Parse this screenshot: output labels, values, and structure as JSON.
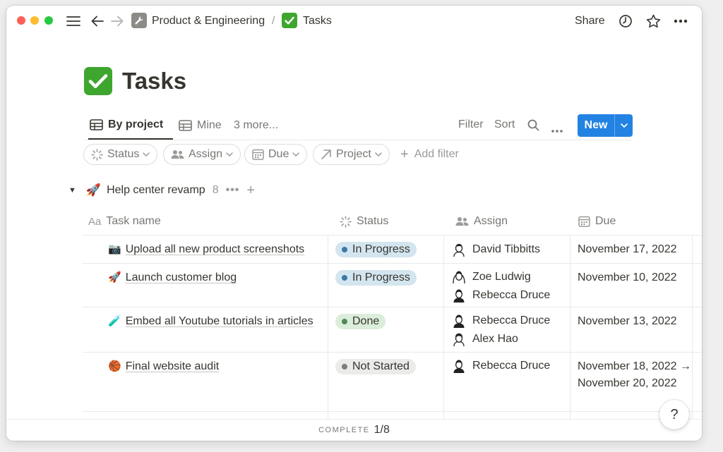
{
  "topbar": {
    "breadcrumb": [
      "Product & Engineering",
      "Tasks"
    ],
    "separator": "/",
    "share_label": "Share"
  },
  "page": {
    "title": "Tasks",
    "icon": "check-mark-icon"
  },
  "views": {
    "tabs": [
      {
        "label": "By project",
        "icon": "table-icon",
        "active": true
      },
      {
        "label": "Mine",
        "icon": "table-icon",
        "active": false
      }
    ],
    "more_label": "3 more...",
    "filter_label": "Filter",
    "sort_label": "Sort",
    "new_label": "New",
    "new_color": "#2383e2"
  },
  "filters": {
    "pills": [
      {
        "label": "Status",
        "icon": "status-icon"
      },
      {
        "label": "Assign",
        "icon": "people-icon"
      },
      {
        "label": "Due",
        "icon": "calendar-icon"
      },
      {
        "label": "Project",
        "icon": "arrow-up-right-icon"
      }
    ],
    "add_filter_label": "Add filter"
  },
  "group": {
    "emoji": "🚀",
    "name": "Help center revamp",
    "count": "8",
    "more": "•••",
    "add": "+"
  },
  "table": {
    "columns": [
      {
        "label": "Task name",
        "icon_text": "Aa"
      },
      {
        "label": "Status",
        "icon": "status-icon"
      },
      {
        "label": "Assign",
        "icon": "people-icon"
      },
      {
        "label": "Due",
        "icon": "calendar-icon"
      }
    ],
    "rows": [
      {
        "emoji": "📷",
        "name": "Upload all new product screenshots",
        "status": "In Progress",
        "assignees": [
          "David Tibbitts"
        ],
        "due": "November 17, 2022"
      },
      {
        "emoji": "🚀",
        "name": "Launch customer blog",
        "status": "In Progress",
        "assignees": [
          "Zoe Ludwig",
          "Rebecca Druce"
        ],
        "due": "November 10, 2022"
      },
      {
        "emoji": "🧪",
        "name": "Embed all Youtube tutorials in articles",
        "status": "Done",
        "assignees": [
          "Rebecca Druce",
          "Alex Hao"
        ],
        "due": "November 13, 2022"
      },
      {
        "emoji": "🏀",
        "name": "Final website audit",
        "status": "Not Started",
        "assignees": [
          "Rebecca Druce"
        ],
        "due": "November 18, 2022 → November 20, 2022"
      }
    ],
    "status_colors": {
      "In Progress": "#d3e5ef",
      "Done": "#dbeddb",
      "Not Started": "#ebebea"
    }
  },
  "footer": {
    "label": "COMPLETE",
    "value": "1/8"
  },
  "help_label": "?"
}
